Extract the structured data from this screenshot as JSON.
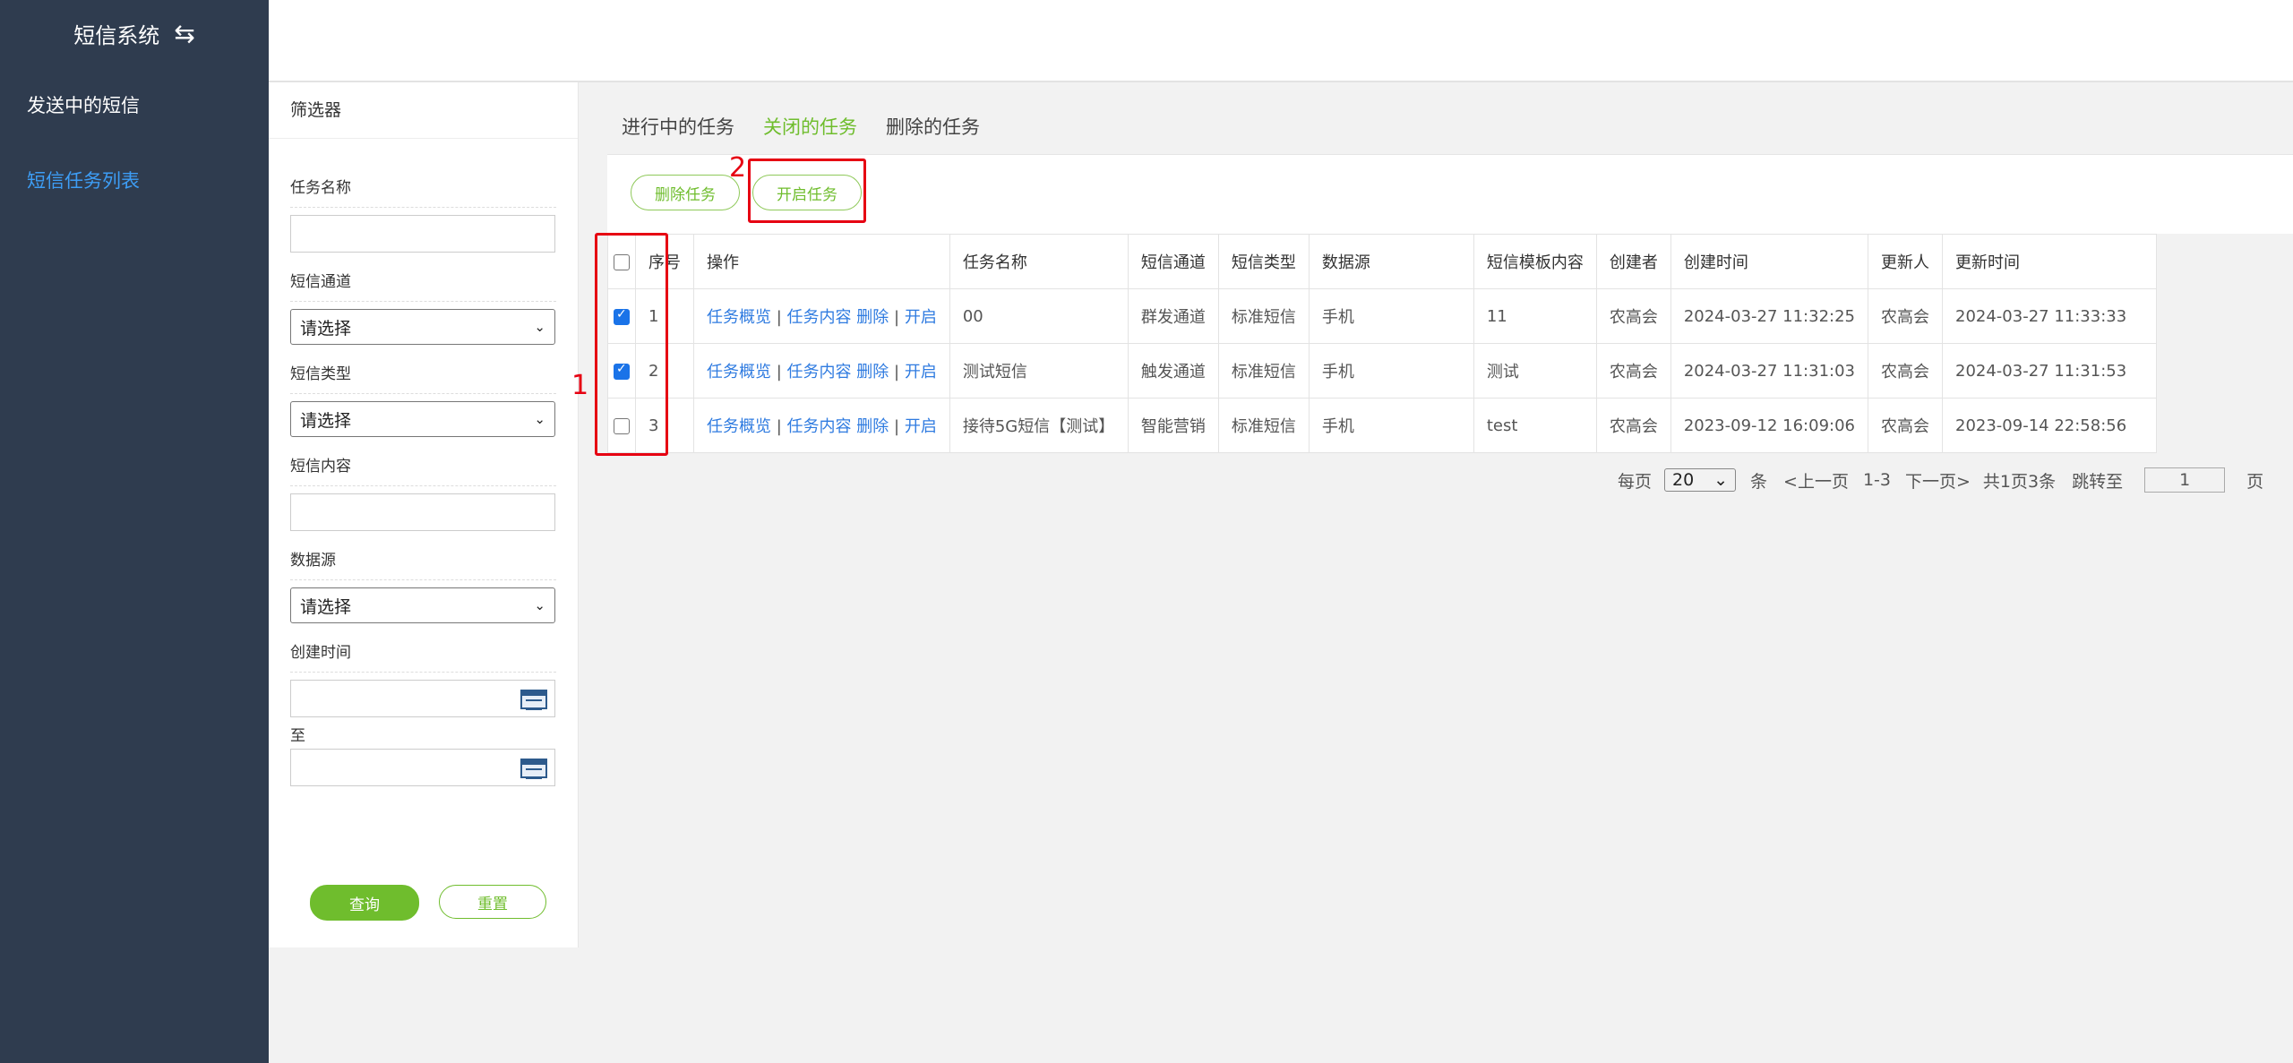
{
  "sidebar": {
    "title": "短信系统",
    "items": [
      {
        "label": "发送中的短信"
      },
      {
        "label": "短信任务列表"
      }
    ]
  },
  "filter": {
    "title": "筛选器",
    "task_name_label": "任务名称",
    "channel_label": "短信通道",
    "channel_value": "请选择",
    "type_label": "短信类型",
    "type_value": "请选择",
    "content_label": "短信内容",
    "datasource_label": "数据源",
    "datasource_value": "请选择",
    "created_label": "创建时间",
    "to_label": "至",
    "query_button": "查询",
    "reset_button": "重置"
  },
  "tabs": [
    {
      "label": "进行中的任务"
    },
    {
      "label": "关闭的任务"
    },
    {
      "label": "删除的任务"
    }
  ],
  "toolbar": {
    "delete_button": "删除任务",
    "open_button": "开启任务"
  },
  "table": {
    "headers": [
      "序号",
      "操作",
      "任务名称",
      "短信通道",
      "短信类型",
      "数据源",
      "短信模板内容",
      "创建者",
      "创建时间",
      "更新人",
      "更新时间"
    ],
    "actions": {
      "overview": "任务概览",
      "sep": "|",
      "content": "任务内容",
      "delete": "删除",
      "open": "开启"
    },
    "rows": [
      {
        "no": "1",
        "name": "00",
        "channel": "群发通道",
        "type": "标准短信",
        "source": "手机",
        "template": "11",
        "creator": "农高会",
        "created": "2024-03-27 11:32:25",
        "updater": "农高会",
        "updated": "2024-03-27 11:33:33",
        "checked": true
      },
      {
        "no": "2",
        "name": "测试短信",
        "channel": "触发通道",
        "type": "标准短信",
        "source": "手机",
        "template": "测试",
        "creator": "农高会",
        "created": "2024-03-27 11:31:03",
        "updater": "农高会",
        "updated": "2024-03-27 11:31:53",
        "checked": true
      },
      {
        "no": "3",
        "name": "接待5G短信【测试】",
        "channel": "智能营销",
        "type": "标准短信",
        "source": "手机",
        "template": "test",
        "creator": "农高会",
        "created": "2023-09-12 16:09:06",
        "updater": "农高会",
        "updated": "2023-09-14 22:58:56",
        "checked": false
      }
    ]
  },
  "pager": {
    "per_page_label": "每页",
    "per_page_value": "20",
    "unit": "条",
    "prev": "<上一页",
    "range": "1-3",
    "next": "下一页>",
    "total": "共1页3条",
    "jump_label": "跳转至",
    "jump_value": "1",
    "page_unit": "页"
  },
  "annotations": {
    "box1": "1",
    "box2": "2"
  },
  "colors": {
    "sidebar_bg": "#2f3c4f",
    "accent_green": "#6fbd2d",
    "active_blue": "#3d9df5",
    "annotation_red": "#e60012"
  }
}
